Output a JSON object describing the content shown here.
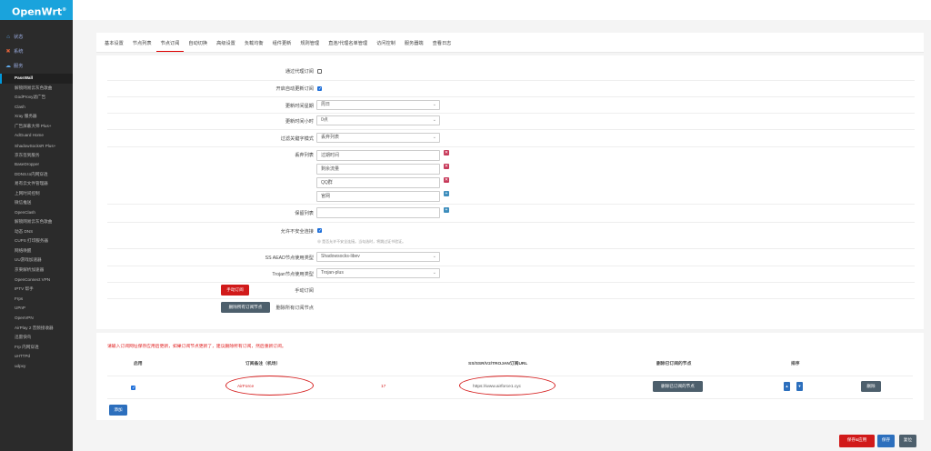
{
  "app": {
    "logo": "OpenWrt",
    "logo_sup": "®"
  },
  "sidebar": {
    "top": [
      {
        "label": "状态",
        "icon": "home-icon"
      },
      {
        "label": "系统",
        "icon": "wrench-icon"
      },
      {
        "label": "服务",
        "icon": "services-icon"
      }
    ],
    "services": [
      "PassWall",
      "解锁网易云灰色歌曲",
      "GodProxy滤广告",
      "Clash",
      "Xray 服务器",
      "广告屏蔽大师 Plus+",
      "AdGuard Home",
      "ShadowSocksR Plus+",
      "京东签到服务",
      "BaseDropper",
      "DDNS.to内网穿透",
      "易有云文件管理器",
      "上网时间控制",
      "微信推送",
      "OpenClash",
      "解锁网易云灰色歌曲",
      "动态 DNS",
      "CUPS 打印服务器",
      "网络唤醒",
      "UU游戏加速器",
      "京東解析加速器",
      "OpenConnect VPN",
      "IPTV 帮手",
      "Frps",
      "UPnP",
      "OpenVPN",
      "AirPlay 2 音频接收器",
      "迅雷快鸟",
      "Frp 内网穿透",
      "uHTTPd",
      "udpxy"
    ]
  },
  "tabs": [
    "基本设置",
    "节点列表",
    "节点订阅",
    "自动切换",
    "高级设置",
    "负载均衡",
    "组件更新",
    "规则管理",
    "直连/代理名单管理",
    "访问控制",
    "服务器端",
    "查看日志"
  ],
  "form": {
    "via_proxy_label": "通过代理订阅",
    "via_proxy_checked": false,
    "auto_update_label": "开启自动更新订阅",
    "auto_update_checked": true,
    "update_week_label": "更新时间星期",
    "update_week_value": "周日",
    "update_hour_label": "更新时间小时",
    "update_hour_value": "0点",
    "filter_mode_label": "过滤关键字模式",
    "filter_mode_value": "丢弃列表",
    "discard_list_label": "丢弃列表",
    "discard_items": [
      "过期时间",
      "剩余流量",
      "QQ群",
      "官网"
    ],
    "keep_list_label": "保留列表",
    "allow_insecure_label": "允许不安全连接",
    "allow_insecure_checked": true,
    "allow_insecure_hint": "⊕ 是否允许不安全连接。当勾选时，将跳过证书验证。",
    "ss_aead_label": "SS AEAD节点使用类型",
    "ss_aead_value": "Shadowsocks-libev",
    "trojan_label": "Trojan节点使用类型",
    "trojan_value": "Trojan-plus",
    "manual_sub_label": "手动订阅",
    "manual_sub_button": "手动订阅",
    "delete_all_label": "删除所有订阅节点",
    "delete_all_button": "删除所有订阅节点"
  },
  "subscription": {
    "warning": "请输入订阅网址保存应用后更新，如果订阅节点更新了，建议删除所有订阅，然后重新订阅。",
    "headers": {
      "enable": "启用",
      "remark": "订阅备注（机场）",
      "url": "SS/SSR/V2/TROJAN订阅URL",
      "delete": "删除已订阅的节点",
      "order": "排序"
    },
    "rows": [
      {
        "enabled": true,
        "remark": "AirForce",
        "count": "17",
        "url": "https://www.airforce1.cyc",
        "delete_nodes_button": "删除已订阅的节点",
        "up": "▲",
        "down": "▼",
        "delete_button": "删除"
      }
    ],
    "add_button": "添加"
  },
  "footer": {
    "save_apply": "保存&应用",
    "save": "保存",
    "reset": "复位"
  },
  "colors": {
    "brand": "#1aa3dc",
    "danger": "#d11a1a",
    "primary": "#2c6fbd"
  }
}
